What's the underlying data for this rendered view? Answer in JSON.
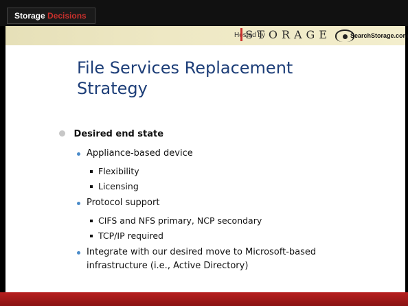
{
  "header": {
    "brand_primary": "Storage",
    "brand_accent": "Decisions",
    "hosted_by": "Hosted by",
    "storage_logo": "STORAGE",
    "searchstorage": "SearchStorage.com"
  },
  "slide": {
    "title": "File Services Replacement Strategy",
    "bullets": [
      {
        "text": "Desired end state"
      },
      {
        "text": "Appliance-based device"
      },
      {
        "text": "Flexibility"
      },
      {
        "text": "Licensing"
      },
      {
        "text": "Protocol support"
      },
      {
        "text": "CIFS and NFS primary, NCP secondary"
      },
      {
        "text": "TCP/IP required"
      },
      {
        "text": "Integrate with our desired move to Microsoft-based"
      },
      {
        "text": "infrastructure (i.e., Active Directory)"
      }
    ]
  },
  "colors": {
    "title": "#1d3e78",
    "accent_red": "#c9302c",
    "sub_bullet": "#4a8bc9",
    "bottom_bar": "#b71e1e"
  }
}
